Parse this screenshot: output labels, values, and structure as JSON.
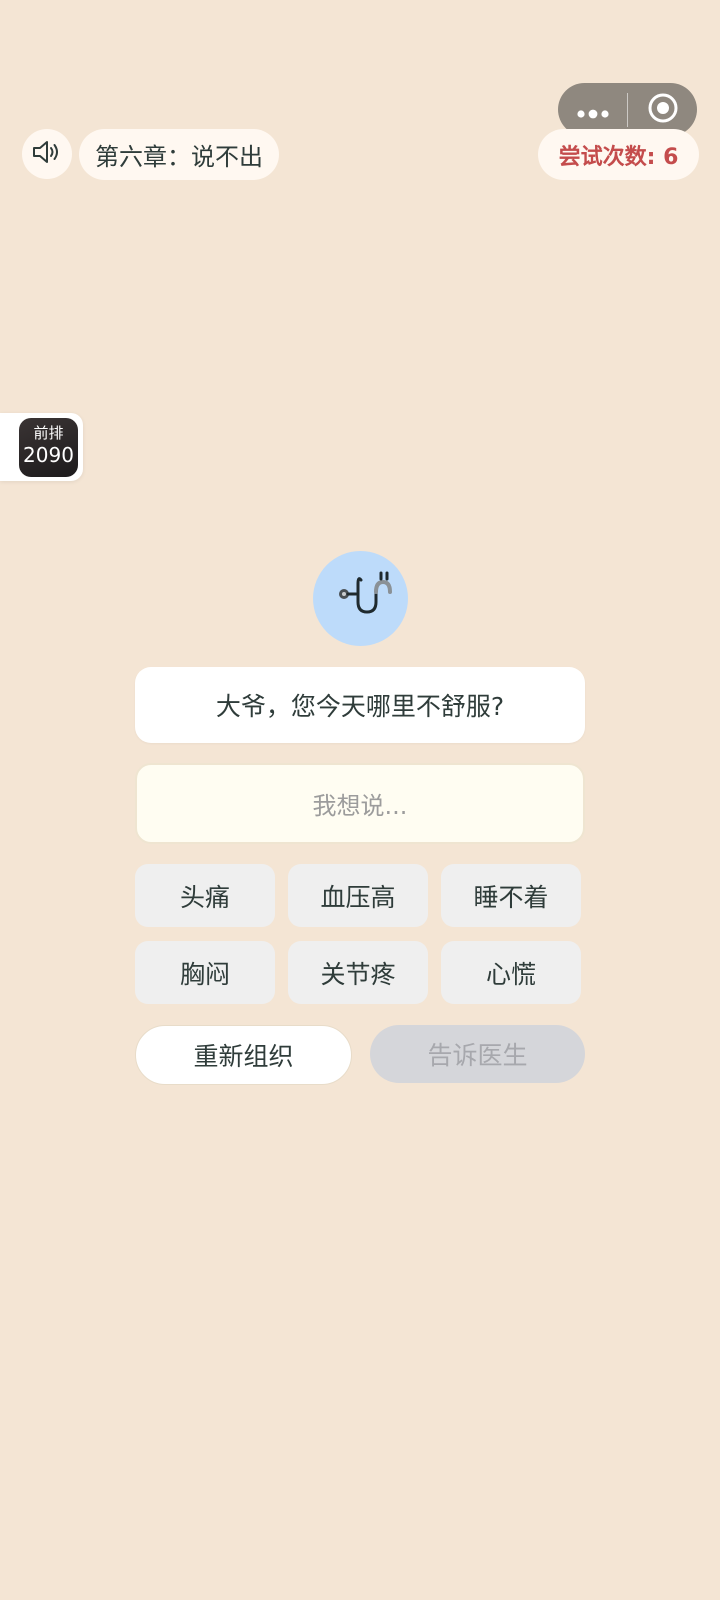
{
  "header": {
    "chapter_title": "第六章：说不出",
    "attempts_label": "尝试次数: 6"
  },
  "capsule": {
    "menu_icon": "more-dots-icon",
    "close_icon": "target-circle-icon",
    "background": "#8f887f"
  },
  "sound": {
    "icon": "speaker-icon"
  },
  "side_badge": {
    "line1": "前排",
    "line2": "2090"
  },
  "avatar": {
    "icon": "stethoscope-icon",
    "background": "#bddbfa"
  },
  "dialog": {
    "question": "大爷，您今天哪里不舒服?",
    "answer_placeholder": "我想说..."
  },
  "choices": [
    "头痛",
    "血压高",
    "睡不着",
    "胸闷",
    "关节疼",
    "心慌"
  ],
  "actions": {
    "reset_label": "重新组织",
    "submit_label": "告诉医生"
  },
  "colors": {
    "page_background": "#f4e5d4",
    "attempts_text": "#c44c4c",
    "choice_background": "#efefef",
    "disabled_button": "#d5d6da"
  }
}
